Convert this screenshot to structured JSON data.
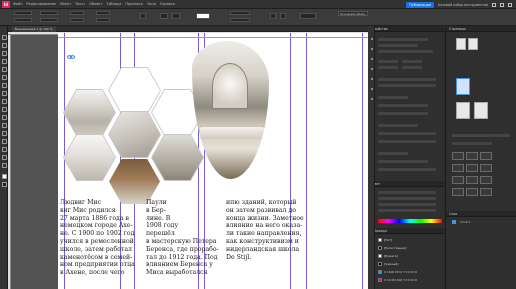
{
  "app": {
    "logo": "Id",
    "menu": [
      "Файл",
      "Редактирование",
      "Макет",
      "Текст",
      "Объект",
      "Таблица",
      "Просмотр",
      "Окно",
      "Справка"
    ],
    "publish_label": "Публикация",
    "workspace_label": "Базовый набор инструментов",
    "preset_label": "Основной абзац"
  },
  "document": {
    "tab_label": "Безымянный-1 @ 100 %"
  },
  "page_text": {
    "column_left": "Людвиг Мис\nвиг Мис родился\n27 марта 1886 года в\nнемецком городе Ахе-\nне. С 1900 по 1902 год\nучился в ремесленной\nшколе, затем работал\nкаменотёсом в семей-\nном предприятии отца\nв Ахене, после чего",
    "column_mid": "Паули\nв Бер-\nлине. В\n1908 году\nперешёл\nв мастерскую Петера\nБеренса, где прорабо-\nтал до 1912 года. Под\nвлиянием Беренса у\nМиса выработался",
    "column_right": "ипю зданий, который\nон затем развивал до\nконца жизни. Заметное\nвлияние на него оказа-\nли такие направления,\nкак конструктивизм и\nнидерландская школа\nDe Stijl."
  },
  "panels": {
    "pages_title": "Страницы",
    "properties_title": "Свойства",
    "swatches_title": "Образцы",
    "color_title": "Цвет",
    "layers_title": "Слои",
    "swatches": [
      {
        "name": "[Нет]",
        "color": "#ffffff"
      },
      {
        "name": "[Регистрация]",
        "color": "#111111"
      },
      {
        "name": "[Бумага]",
        "color": "#ffffff"
      },
      {
        "name": "[Черный]",
        "color": "#000000"
      },
      {
        "name": "C=100 M=0 Y=0 K=0",
        "color": "#00aeef"
      },
      {
        "name": "C=0 M=100 Y=0 K=0",
        "color": "#ec008c"
      }
    ],
    "layer_name": "Слой 1"
  },
  "colors": {
    "accent": "#1473e6",
    "brand": "#e2246d",
    "guide_violet": "#7b5cd6",
    "guide_magenta": "#e36de1"
  }
}
